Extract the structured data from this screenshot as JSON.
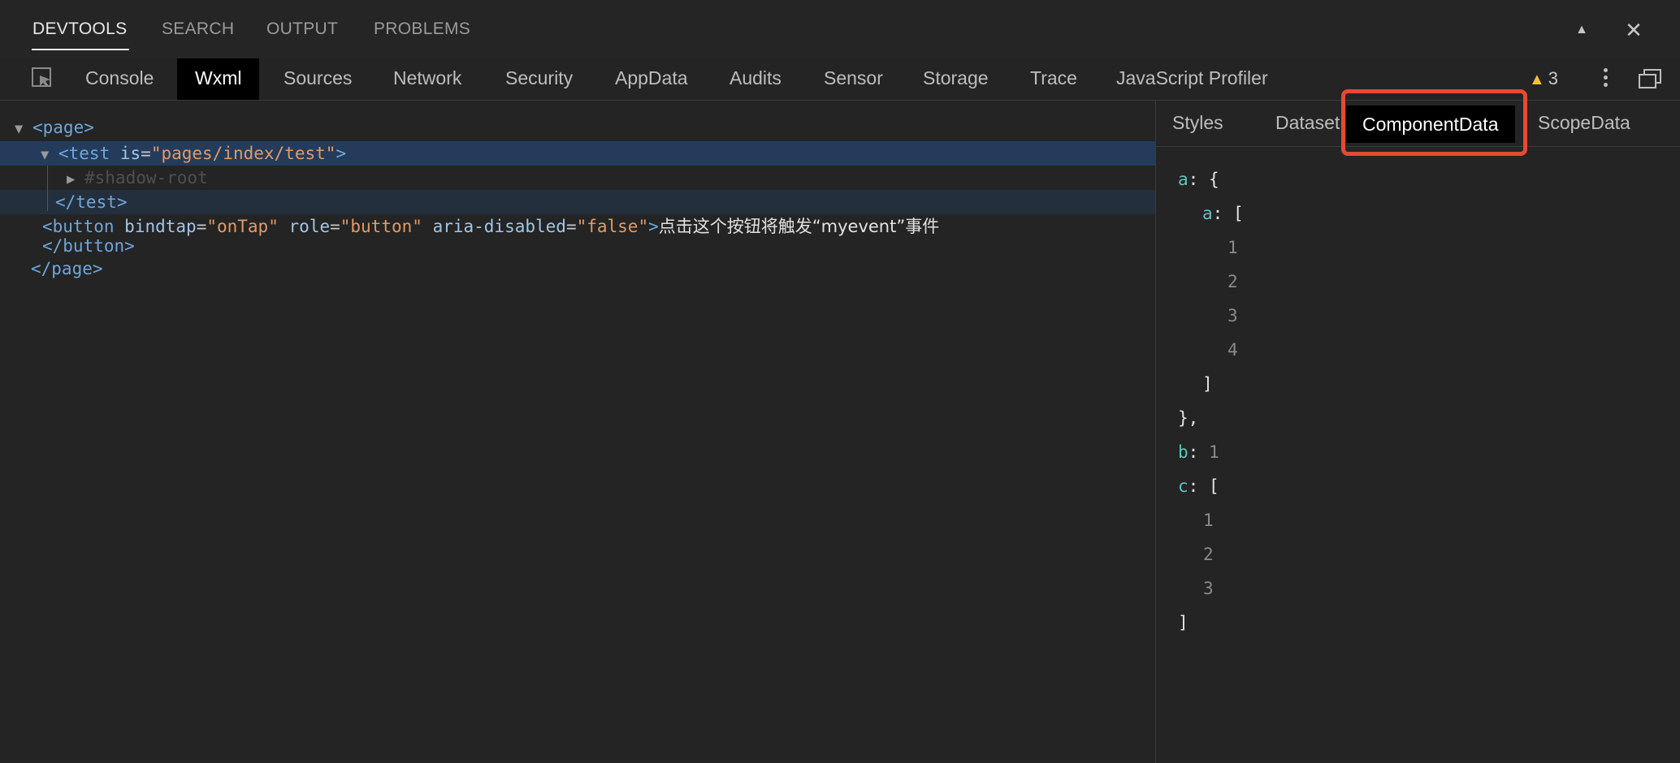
{
  "panel_tabs": [
    "DEVTOOLS",
    "SEARCH",
    "OUTPUT",
    "PROBLEMS"
  ],
  "panel_controls": {
    "collapse": "▲",
    "close": "✕"
  },
  "devtools_tabs": [
    "Console",
    "Wxml",
    "Sources",
    "Network",
    "Security",
    "AppData",
    "Audits",
    "Sensor",
    "Storage",
    "Trace",
    "JavaScript Profiler"
  ],
  "active_devtools_tab": "Wxml",
  "warnings": {
    "icon": "warning-icon",
    "count": "3"
  },
  "wxml": {
    "page_open": "<page>",
    "test_tag": "<test",
    "test_attr": "is",
    "test_val": "\"pages/index/test\"",
    "test_close_bracket": ">",
    "shadow_root": "#shadow-root",
    "test_end": "</test>",
    "button_tag": "<button",
    "button_attr1": "bindtap",
    "button_val1": "\"onTap\"",
    "button_attr2": "role",
    "button_val2": "\"button\"",
    "button_attr3": "aria-disabled",
    "button_val3": "\"false\"",
    "button_close_bracket": ">",
    "button_text": "点击这个按钮将触发“myevent”事件",
    "button_end": "</button>",
    "page_end": "</page>"
  },
  "side_tabs": [
    "Styles",
    "Dataset",
    "ComponentData",
    "ScopeData"
  ],
  "active_side_tab": "ComponentData",
  "component_data": {
    "a_key": "a",
    "inner_a_key": "a",
    "inner_a_values": [
      "1",
      "2",
      "3",
      "4"
    ],
    "b_key": "b",
    "b_value": "1",
    "c_key": "c",
    "c_values": [
      "1",
      "2",
      "3"
    ]
  },
  "colors": {
    "highlight_border": "#e54a32",
    "selected_row": "#243b5c",
    "tag": "#6fa6dc",
    "attr_value": "#e39a63",
    "json_key": "#5ec3c3"
  }
}
